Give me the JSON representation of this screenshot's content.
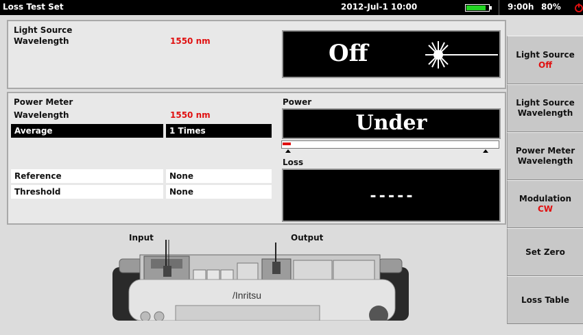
{
  "topbar": {
    "title": "Loss Test Set",
    "datetime": "2012-Jul-1 10:00",
    "battery_time": "9:00h",
    "battery_percent": "80%"
  },
  "light_source": {
    "heading": "Light Source",
    "wavelength_label": "Wavelength",
    "wavelength_value": "1550 nm",
    "status": "Off"
  },
  "power_meter": {
    "heading": "Power Meter",
    "wavelength_label": "Wavelength",
    "wavelength_value": "1550 nm",
    "average_label": "Average",
    "average_value": "1 Times",
    "reference_label": "Reference",
    "reference_value": "None",
    "threshold_label": "Threshold",
    "threshold_value": "None",
    "power_label": "Power",
    "power_value": "Under",
    "loss_label": "Loss",
    "loss_value": "-----"
  },
  "device": {
    "input_label": "Input",
    "output_label": "Output",
    "brand": "/Inritsu"
  },
  "sidebar": {
    "buttons": [
      {
        "label": "Light Source",
        "sub": "Off"
      },
      {
        "label": "Light Source",
        "label2": "Wavelength"
      },
      {
        "label": "Power Meter",
        "label2": "Wavelength"
      },
      {
        "label": "Modulation",
        "sub": "CW"
      },
      {
        "label": "Set Zero"
      },
      {
        "label": "Loss Table"
      }
    ]
  },
  "colors": {
    "accent_red": "#e01010",
    "battery_green": "#23d423"
  }
}
